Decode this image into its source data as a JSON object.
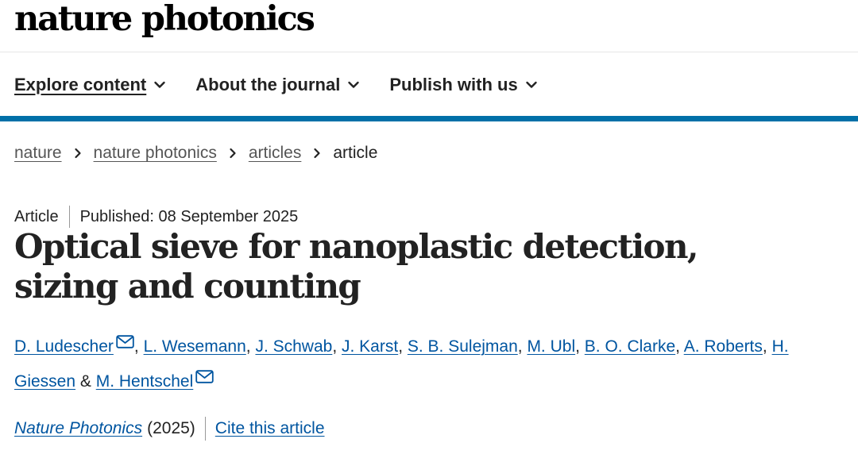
{
  "header": {
    "logo_text": "nature photonics"
  },
  "nav": {
    "items": [
      {
        "label": "Explore content",
        "active": true
      },
      {
        "label": "About the journal",
        "active": false
      },
      {
        "label": "Publish with us",
        "active": false
      }
    ]
  },
  "breadcrumb": {
    "items": [
      "nature",
      "nature photonics",
      "articles"
    ],
    "current": "article"
  },
  "article": {
    "type": "Article",
    "published": "Published: 08 September 2025",
    "title": "Optical sieve for nanoplastic detection, sizing and counting",
    "authors": [
      {
        "name": "D. Ludescher",
        "corresponding": true
      },
      {
        "name": "L. Wesemann",
        "corresponding": false
      },
      {
        "name": "J. Schwab",
        "corresponding": false
      },
      {
        "name": "J. Karst",
        "corresponding": false
      },
      {
        "name": "S. B. Sulejman",
        "corresponding": false
      },
      {
        "name": "M. Ubl",
        "corresponding": false
      },
      {
        "name": "B. O. Clarke",
        "corresponding": false
      },
      {
        "name": "A. Roberts",
        "corresponding": false
      },
      {
        "name": "H. Giessen",
        "corresponding": false
      },
      {
        "name": "M. Hentschel",
        "corresponding": true
      }
    ],
    "author_separator": ", ",
    "author_last_separator": " & ",
    "journal": "Nature Photonics",
    "year": "(2025)",
    "cite_label": "Cite this article"
  },
  "colors": {
    "accent": "#0070a8",
    "link": "#0055a0",
    "text": "#222222"
  }
}
